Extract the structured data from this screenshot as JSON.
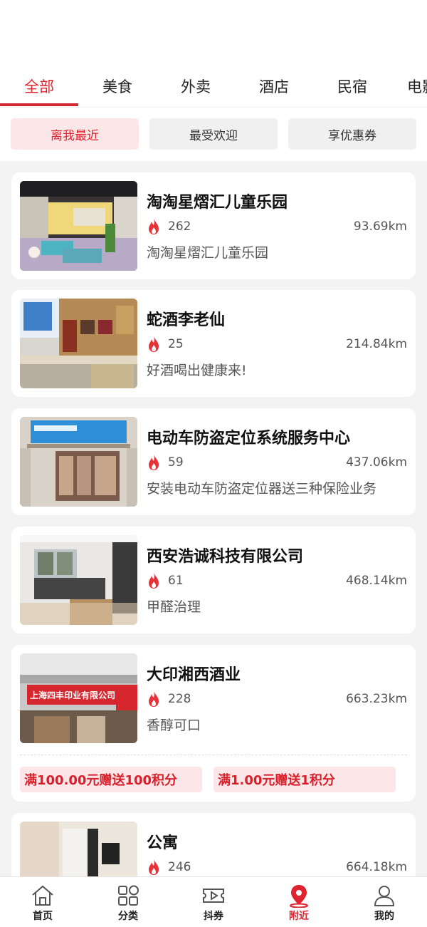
{
  "tabs": [
    "全部",
    "美食",
    "外卖",
    "酒店",
    "民宿",
    "电影"
  ],
  "filters": [
    "离我最近",
    "最受欢迎",
    "享优惠券"
  ],
  "colors": {
    "accent": "#e0242f",
    "promo_bg": "#fde6e7"
  },
  "shops": [
    {
      "name": "淘淘星熠汇儿童乐园",
      "hot": "262",
      "distance": "93.69km",
      "desc": "淘淘星熠汇儿童乐园",
      "icon": "flame-icon"
    },
    {
      "name": "蛇酒李老仙",
      "hot": "25",
      "distance": "214.84km",
      "desc": "好酒喝出健康来!",
      "icon": "flame-icon"
    },
    {
      "name": "电动车防盗定位系统服务中心",
      "hot": "59",
      "distance": "437.06km",
      "desc": "安装电动车防盗定位器送三种保险业务",
      "icon": "flame-icon"
    },
    {
      "name": "西安浩诚科技有限公司",
      "hot": "61",
      "distance": "468.14km",
      "desc": "甲醛治理",
      "icon": "flame-icon"
    },
    {
      "name": "大印湘西酒业",
      "hot": "228",
      "distance": "663.23km",
      "desc": "香醇可口",
      "icon": "flame-icon",
      "promos": [
        "满100.00元赠送100积分",
        "满1.00元赠送1积分"
      ],
      "sign_text": "上海四丰印业有限公司"
    },
    {
      "name": "公寓",
      "hot": "246",
      "distance": "664.18km",
      "desc": "",
      "icon": "flame-icon"
    }
  ],
  "tabbar": [
    {
      "label": "首页",
      "icon": "home-icon"
    },
    {
      "label": "分类",
      "icon": "category-icon"
    },
    {
      "label": "抖券",
      "icon": "video-ticket-icon"
    },
    {
      "label": "附近",
      "icon": "location-pin-icon"
    },
    {
      "label": "我的",
      "icon": "user-icon"
    }
  ]
}
